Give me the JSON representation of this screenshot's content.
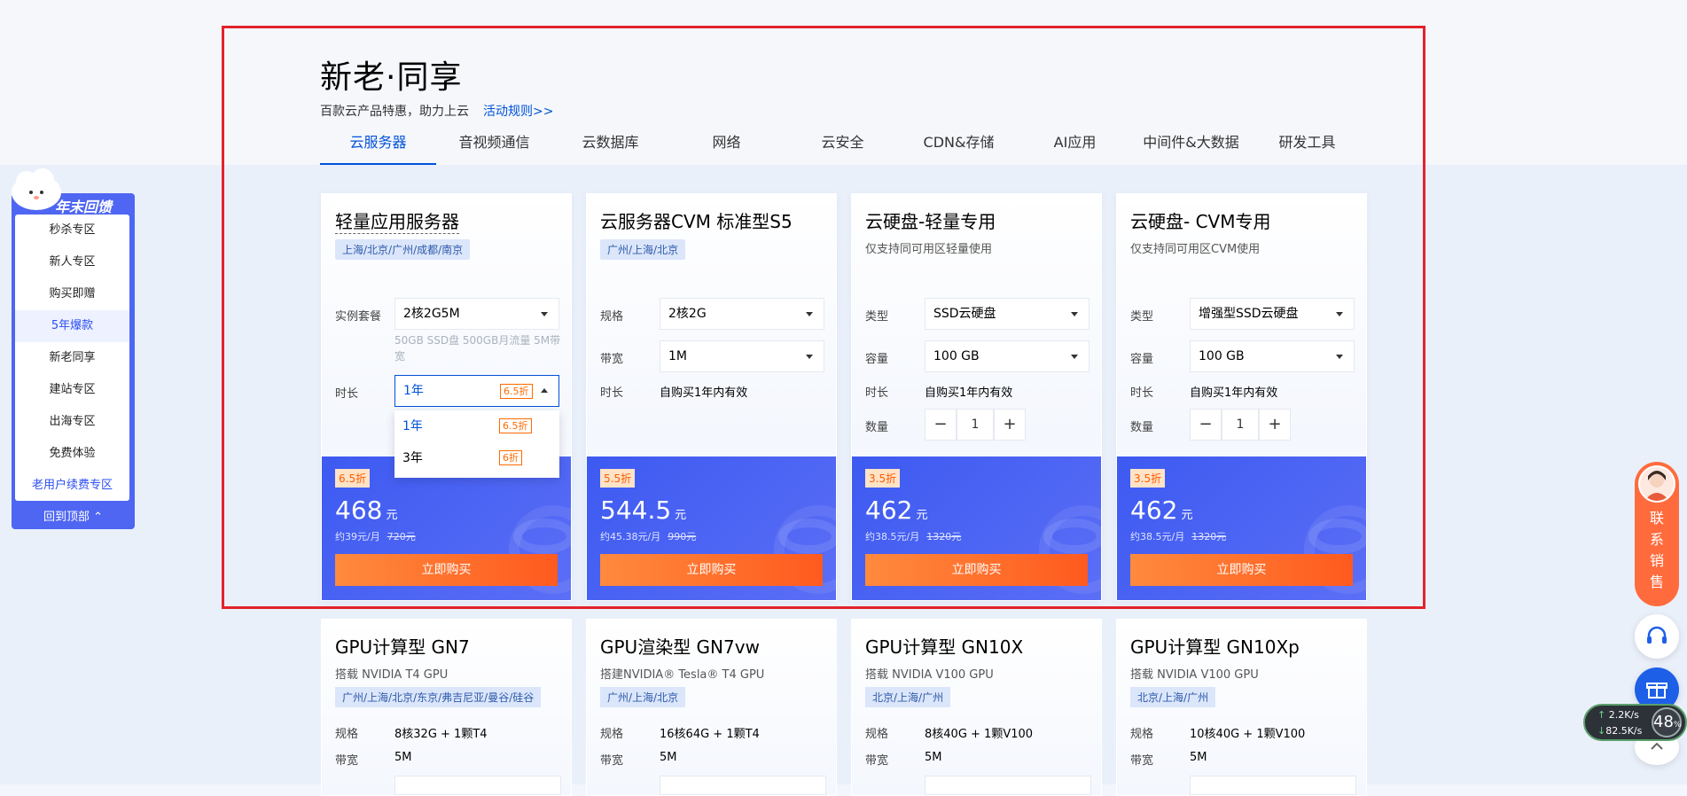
{
  "header": {
    "title": "新老·同享",
    "subtitle": "百款云产品特惠，助力上云",
    "rules_link": "活动规则>>"
  },
  "tabs": [
    "云服务器",
    "音视频通信",
    "云数据库",
    "网络",
    "云安全",
    "CDN&存储",
    "AI应用",
    "中间件&大数据",
    "研发工具"
  ],
  "side_nav": {
    "header": "年末回馈",
    "items": [
      "秒杀专区",
      "新人专区",
      "购买即赠",
      "5年爆款",
      "新老同享",
      "建站专区",
      "出海专区",
      "免费体验",
      "老用户续费专区"
    ],
    "back_to_top": "回到顶部"
  },
  "cards": [
    {
      "title": "轻量应用服务器",
      "region": "上海/北京/广州/成都/南京",
      "plan_label": "实例套餐",
      "plan_value": "2核2G5M",
      "plan_note": "50GB SSD盘 500GB月流量 5M带宽",
      "duration_label": "时长",
      "duration_value": "1年",
      "duration_discount": "6.5折",
      "options": [
        {
          "label": "1年",
          "discount": "6.5折"
        },
        {
          "label": "3年",
          "discount": "6折"
        }
      ],
      "badge": "6.5折",
      "price": "468",
      "unit": "元",
      "monthly": "约39元/月",
      "original": "720元",
      "buy": "立即购买"
    },
    {
      "title": "云服务器CVM 标准型S5",
      "region": "广州/上海/北京",
      "spec_label": "规格",
      "spec_value": "2核2G",
      "bw_label": "带宽",
      "bw_value": "1M",
      "duration_label": "时长",
      "duration_value": "自购买1年内有效",
      "badge": "5.5折",
      "price": "544.5",
      "unit": "元",
      "monthly": "约45.38元/月",
      "original": "990元",
      "buy": "立即购买"
    },
    {
      "title": "云硬盘-轻量专用",
      "desc": "仅支持同可用区轻量使用",
      "type_label": "类型",
      "type_value": "SSD云硬盘",
      "cap_label": "容量",
      "cap_value": "100 GB",
      "duration_label": "时长",
      "duration_value": "自购买1年内有效",
      "qty_label": "数量",
      "qty": "1",
      "badge": "3.5折",
      "price": "462",
      "unit": "元",
      "monthly": "约38.5元/月",
      "original": "1320元",
      "buy": "立即购买"
    },
    {
      "title": "云硬盘- CVM专用",
      "desc": "仅支持同可用区CVM使用",
      "type_label": "类型",
      "type_value": "增强型SSD云硬盘",
      "cap_label": "容量",
      "cap_value": "100 GB",
      "duration_label": "时长",
      "duration_value": "自购买1年内有效",
      "qty_label": "数量",
      "qty": "1",
      "badge": "3.5折",
      "price": "462",
      "unit": "元",
      "monthly": "约38.5元/月",
      "original": "1320元",
      "buy": "立即购买"
    }
  ],
  "gpu_cards": [
    {
      "title": "GPU计算型 GN7",
      "desc": "搭载 NVIDIA T4 GPU",
      "region": "广州/上海/北京/东京/弗吉尼亚/曼谷/硅谷",
      "spec_label": "规格",
      "spec": "8核32G + 1颗T4",
      "bw_label": "带宽",
      "bw": "5M"
    },
    {
      "title": "GPU渲染型 GN7vw",
      "desc": "搭建NVIDIA® Tesla® T4 GPU",
      "region": "广州/上海/北京",
      "spec_label": "规格",
      "spec": "16核64G + 1颗T4",
      "bw_label": "带宽",
      "bw": "5M"
    },
    {
      "title": "GPU计算型 GN10X",
      "desc": "搭载 NVIDIA V100 GPU",
      "region": "北京/上海/广州",
      "spec_label": "规格",
      "spec": "8核40G + 1颗V100",
      "bw_label": "带宽",
      "bw": "5M"
    },
    {
      "title": "GPU计算型 GN10Xp",
      "desc": "搭载 NVIDIA V100 GPU",
      "region": "北京/上海/广州",
      "spec_label": "规格",
      "spec": "10核40G + 1颗V100",
      "bw_label": "带宽",
      "bw": "5M"
    }
  ],
  "right_float": {
    "contact_label": "联系销售",
    "upload_speed": "2.2K/s",
    "download_speed": "82.5K/s",
    "percent": "48"
  },
  "colors": {
    "accent": "#0052d9",
    "price_area": "#4a5ff3",
    "buy_button": "#ff6a2a",
    "highlight_border": "#e3222b"
  }
}
